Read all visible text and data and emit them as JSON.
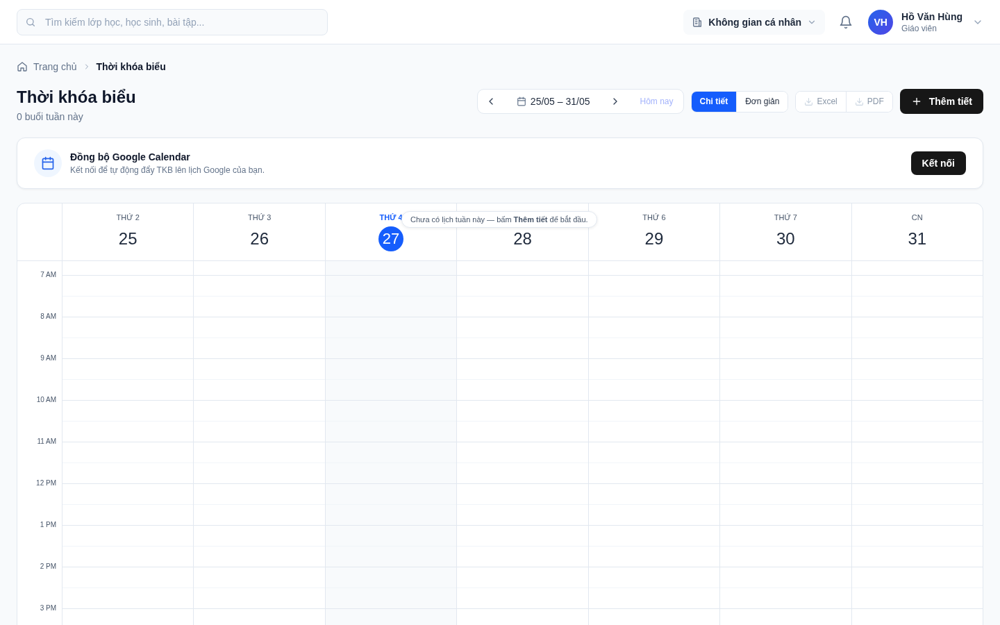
{
  "search": {
    "placeholder": "Tìm kiếm lớp học, học sinh, bài tập..."
  },
  "workspace": {
    "label": "Không gian cá nhân"
  },
  "user": {
    "initials": "VH",
    "name": "Hồ Văn Hùng",
    "role": "Giáo viên"
  },
  "breadcrumb": [
    {
      "label": "Trang chủ",
      "current": false
    },
    {
      "label": "Thời khóa biểu",
      "current": true
    }
  ],
  "page": {
    "title": "Thời khóa biểu",
    "subtitle": "0 buổi tuần này"
  },
  "week_nav": {
    "range": "25/05 – 31/05",
    "today": "Hôm nay",
    "today_disabled": true
  },
  "view_modes": [
    {
      "label": "Chi tiết",
      "selected": true
    },
    {
      "label": "Đơn giản",
      "selected": false
    }
  ],
  "exports": [
    {
      "label": "Excel",
      "disabled": true
    },
    {
      "label": "PDF",
      "disabled": true
    }
  ],
  "add_button": "Thêm tiết",
  "sync_card": {
    "title": "Đồng bộ Google Calendar",
    "description": "Kết nối để tự động đẩy TKB lên lịch Google của bạn.",
    "button": "Kết nối"
  },
  "calendar": {
    "days": [
      {
        "weekday": "THỨ 2",
        "date": "25",
        "today": false
      },
      {
        "weekday": "THỨ 3",
        "date": "26",
        "today": false
      },
      {
        "weekday": "THỨ 4",
        "date": "27",
        "today": true
      },
      {
        "date": "28",
        "today": false
      },
      {
        "weekday": "THỨ 6",
        "date": "29",
        "today": false
      },
      {
        "weekday": "THỨ 7",
        "date": "30",
        "today": false
      },
      {
        "weekday": "CN",
        "date": "31",
        "today": false
      }
    ],
    "hours": [
      "7 AM",
      "8 AM",
      "9 AM",
      "10 AM",
      "11 AM",
      "12 PM",
      "1 PM",
      "2 PM",
      "3 PM"
    ],
    "empty_hint": "Chưa có lịch tuần này — bấm **Thêm tiết** để bắt đầu."
  }
}
